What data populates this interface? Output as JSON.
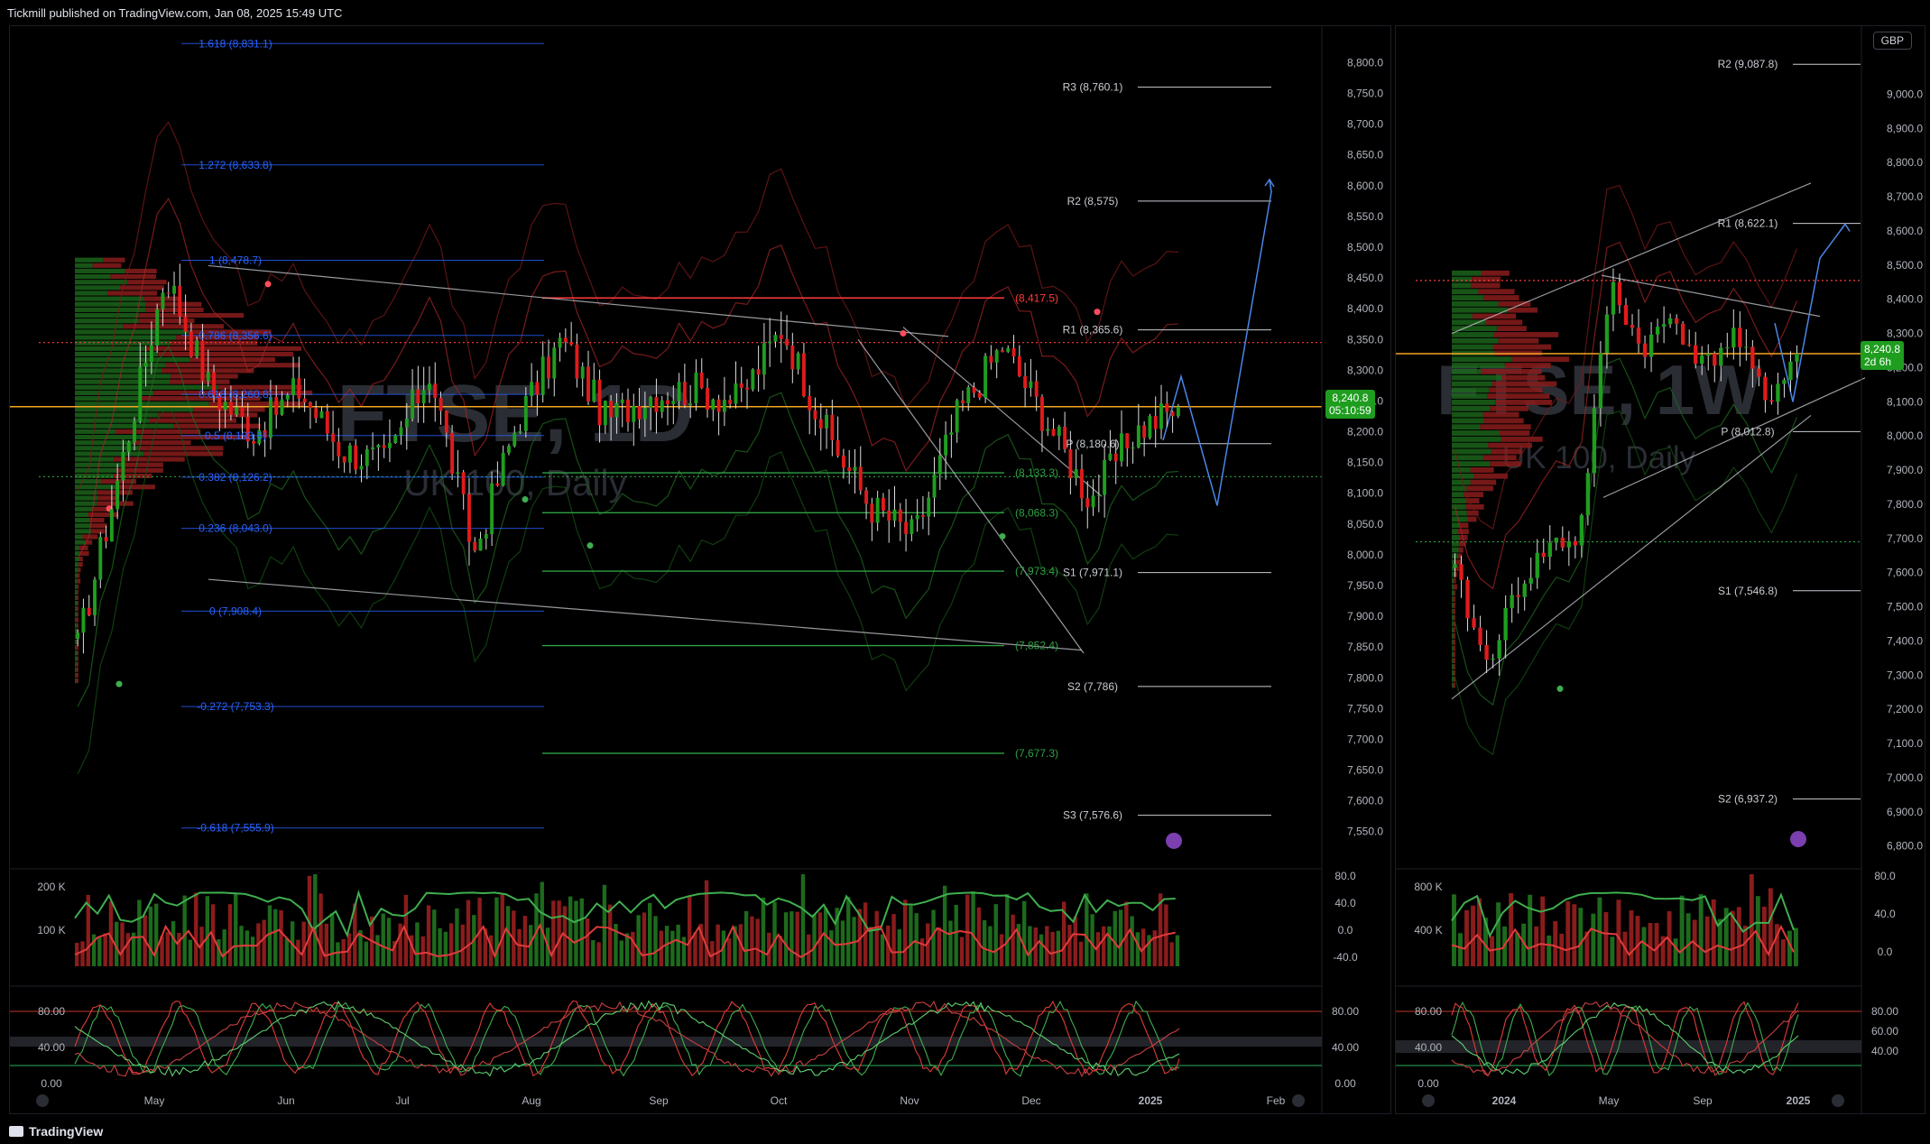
{
  "header": {
    "published": "Tickmill published on TradingView.com, Jan 08, 2025 15:49 UTC"
  },
  "footer": {
    "brand": "TradingView"
  },
  "colors": {
    "bull": "#1f9d1f",
    "bear": "#e01b1b",
    "price_line": "#f5a623",
    "fib": "#2962ff",
    "pivot": "#c9ccd3",
    "green_level": "#2ea043",
    "red_level": "#ff3b3b"
  },
  "chart_data": [
    {
      "type": "candlestick",
      "watermark": {
        "symbol": "FTSE, 1D",
        "name": "UK 100, Daily"
      },
      "x_ticks": [
        "May",
        "Jun",
        "Jul",
        "Aug",
        "Sep",
        "Oct",
        "Nov",
        "Dec",
        "2025",
        "Feb"
      ],
      "y_ticks": [
        "8,800.0",
        "8,750.0",
        "8,700.0",
        "8,650.0",
        "8,600.0",
        "8,550.0",
        "8,500.0",
        "8,450.0",
        "8,400.0",
        "8,350.0",
        "8,300.0",
        "8,250.0",
        "8,200.0",
        "8,150.0",
        "8,100.0",
        "8,050.0",
        "8,000.0",
        "7,950.0",
        "7,900.0",
        "7,850.0",
        "7,800.0",
        "7,750.0",
        "7,700.0",
        "7,650.0",
        "7,600.0",
        "7,550.0"
      ],
      "ylim": [
        7510,
        8830
      ],
      "last_price": {
        "value": "8,240.8",
        "countdown": "05:10:59"
      },
      "fib_levels": [
        {
          "label": "1.618 (8,831.1)",
          "value": 8831.1
        },
        {
          "label": "1.272 (8,633.8)",
          "value": 8633.8
        },
        {
          "label": "1 (8,478.7)",
          "value": 8478.7
        },
        {
          "label": "0.786 (8,356.6)",
          "value": 8356.6
        },
        {
          "label": "0.618 (8,260.8)",
          "value": 8260.8
        },
        {
          "label": "0.5 (8,193.8)",
          "value": 8193.8
        },
        {
          "label": "0.382 (8,126.2)",
          "value": 8126.2
        },
        {
          "label": "0.236 (8,043.0)",
          "value": 8043.0
        },
        {
          "label": "0 (7,908.4)",
          "value": 7908.4
        },
        {
          "label": "-0.272 (7,753.3)",
          "value": 7753.3
        },
        {
          "label": "-0.618 (7,555.9)",
          "value": 7555.9
        }
      ],
      "pivots": [
        {
          "label": "R3 (8,760.1)",
          "value": 8760.1
        },
        {
          "label": "R2 (8,575)",
          "value": 8575
        },
        {
          "label": "R1 (8,365.6)",
          "value": 8365.6
        },
        {
          "label": "P (8,180.6)",
          "value": 8180.6
        },
        {
          "label": "S1 (7,971.1)",
          "value": 7971.1
        },
        {
          "label": "S2 (7,786)",
          "value": 7786
        },
        {
          "label": "S3 (7,576.6)",
          "value": 7576.6
        }
      ],
      "levels": [
        {
          "label": "(8,417.5)",
          "value": 8417.5,
          "kind": "red"
        },
        {
          "label": "(8,133.3)",
          "value": 8133.3,
          "kind": "green"
        },
        {
          "label": "(8,068.3)",
          "value": 8068.3,
          "kind": "green"
        },
        {
          "label": "(7,973.4)",
          "value": 7973.4,
          "kind": "green"
        },
        {
          "label": "(7,852.4)",
          "value": 7852.4,
          "kind": "green"
        },
        {
          "label": "(7,677.3)",
          "value": 7677.3,
          "kind": "green"
        }
      ],
      "volume_ticks": [
        "200 K",
        "100 K"
      ],
      "volume_osc_ticks": [
        "80.0",
        "40.0",
        "0.0",
        "-40.0"
      ],
      "stoch_ticks_left": [
        "80.00",
        "40.00",
        "0.00"
      ],
      "stoch_ticks_right": [
        "80.00",
        "40.00",
        "0.00"
      ]
    },
    {
      "type": "candlestick",
      "watermark": {
        "symbol": "FTSE, 1W",
        "name": "UK 100, Daily"
      },
      "currency": "GBP",
      "x_ticks": [
        "2024",
        "May",
        "Sep",
        "2025"
      ],
      "y_ticks": [
        "9,000.0",
        "8,900.0",
        "8,800.0",
        "8,700.0",
        "8,600.0",
        "8,500.0",
        "8,400.0",
        "8,300.0",
        "8,200.0",
        "8,100.0",
        "8,000.0",
        "7,900.0",
        "7,800.0",
        "7,700.0",
        "7,600.0",
        "7,500.0",
        "7,400.0",
        "7,300.0",
        "7,200.0",
        "7,100.0",
        "7,000.0",
        "6,900.0",
        "6,800.0"
      ],
      "ylim": [
        6770,
        9120
      ],
      "last_price": {
        "value": "8,240.8",
        "countdown": "2d 6h"
      },
      "pivots": [
        {
          "label": "R2 (9,087.8)",
          "value": 9087.8
        },
        {
          "label": "R1 (8,622.1)",
          "value": 8622.1
        },
        {
          "label": "P (8,012.8)",
          "value": 8012.8
        },
        {
          "label": "S1 (7,546.8)",
          "value": 7546.8
        },
        {
          "label": "S2 (6,937.2)",
          "value": 6937.2
        }
      ],
      "volume_ticks": [
        "800 K",
        "400 K"
      ],
      "volume_osc_ticks": [
        "80.0",
        "40.0",
        "0.0"
      ],
      "stoch_ticks_left": [
        "80.00",
        "40.00",
        "0.00"
      ],
      "stoch_ticks_right": [
        "80.00",
        "60.00",
        "40.00"
      ]
    }
  ]
}
